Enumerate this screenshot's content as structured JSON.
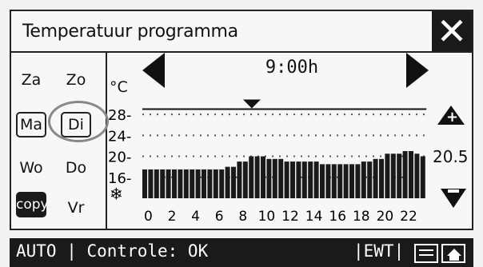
{
  "title": "Temperatuur programma",
  "close_icon": "close-icon",
  "days": {
    "za": "Za",
    "zo": "Zo",
    "ma": "Ma",
    "di": "Di",
    "wo": "Wo",
    "do": "Do",
    "copy": "copy",
    "vr": "Vr"
  },
  "selected_day": "Di",
  "time": "9:00h",
  "unit": "°C",
  "setpoint": "20.5",
  "status": {
    "text": "AUTO | Controle: OK",
    "ewt": "|EWT|"
  },
  "chart_data": {
    "type": "bar",
    "x": [
      0,
      0.5,
      1,
      1.5,
      2,
      2.5,
      3,
      3.5,
      4,
      4.5,
      5,
      5.5,
      6,
      6.5,
      7,
      7.5,
      8,
      8.5,
      9,
      9.5,
      10,
      10.5,
      11,
      11.5,
      12,
      12.5,
      13,
      13.5,
      14,
      14.5,
      15,
      15.5,
      16,
      16.5,
      17,
      17.5,
      18,
      18.5,
      19,
      19.5,
      20,
      20.5,
      21,
      21.5,
      22,
      22.5,
      23,
      23.5
    ],
    "values": [
      17.5,
      17.5,
      17.5,
      17.5,
      17.5,
      17.5,
      17.5,
      17.5,
      17.5,
      17.5,
      17.5,
      17.5,
      17.5,
      17.5,
      18,
      18,
      19,
      19,
      20,
      20,
      20,
      19.5,
      19.5,
      19.5,
      19,
      19,
      19,
      19,
      19,
      19,
      18.5,
      18.5,
      18.5,
      18.5,
      18.5,
      18.5,
      18.5,
      19,
      19,
      19.5,
      19.5,
      20.5,
      20.5,
      20.5,
      21,
      21,
      20.5,
      20
    ],
    "xticks": [
      "0",
      "2",
      "4",
      "6",
      "8",
      "10",
      "12",
      "14",
      "16",
      "18",
      "20",
      "22"
    ],
    "yticks": [
      "28-",
      "24-",
      "20-",
      "16-"
    ],
    "ylim": [
      12,
      30
    ],
    "reference_line": 29,
    "reference_line_label": "",
    "frost_icon": "snowflake-icon",
    "grid": true
  }
}
